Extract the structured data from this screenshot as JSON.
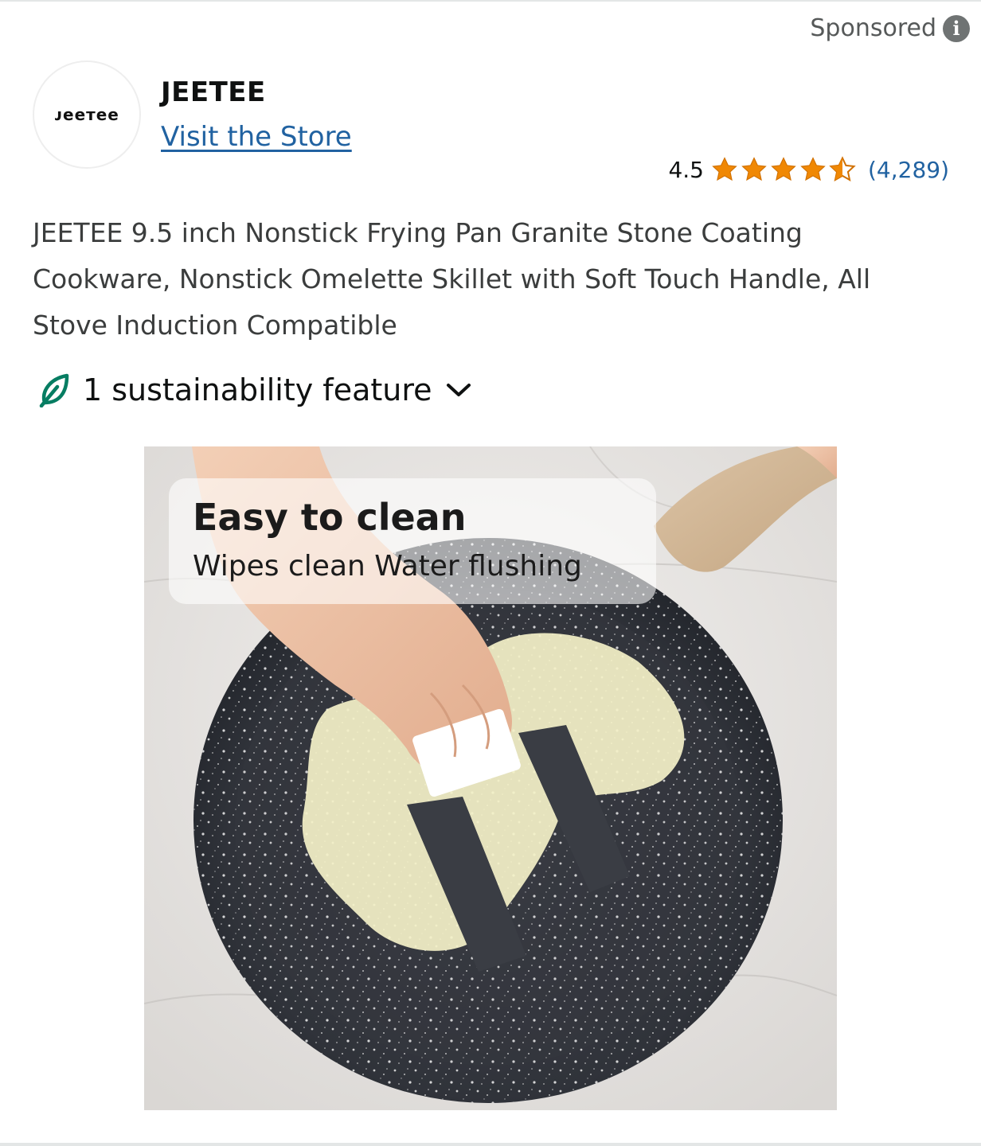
{
  "header": {
    "sponsored_label": "Sponsored",
    "info_icon": "info-icon"
  },
  "store": {
    "logo_text": "ᴊeeтee",
    "name": "JEETEE",
    "visit_label": "Visit the Store"
  },
  "rating": {
    "value": "4.5",
    "stars": 4.5,
    "count_label": "(4,289)",
    "star_color": "#f08804",
    "link_color": "#2162a1"
  },
  "product": {
    "title": "JEETEE 9.5 inch Nonstick Frying Pan Granite Stone Coating Cookware, Nonstick Omelette Skillet with Soft Touch Handle, All Stove Induction Compatible"
  },
  "sustainability": {
    "label": "1 sustainability feature",
    "icon": "leaf-icon",
    "chevron": "chevron-down-icon",
    "icon_color": "#067d62"
  },
  "image": {
    "overlay_title": "Easy to clean",
    "overlay_subtitle": "Wipes clean Water flushing"
  }
}
